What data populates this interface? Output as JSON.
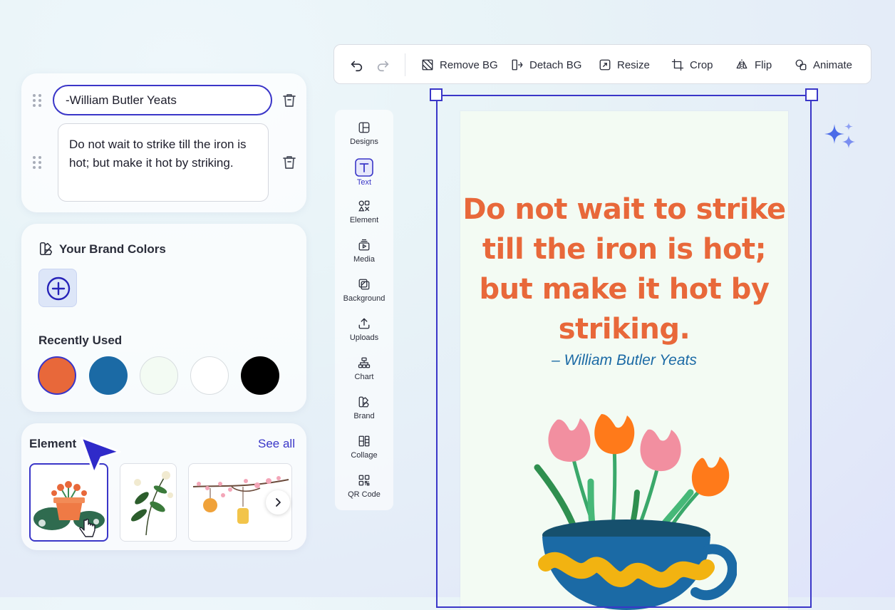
{
  "quote_editor": {
    "author_value": "-William Butler Yeats",
    "quote_value": "Do not wait to strike till the iron is hot; but make it hot by striking."
  },
  "brand": {
    "title": "Your Brand Colors",
    "recent_title": "Recently Used",
    "recent_colors": [
      "#e8683a",
      "#1b6aa5",
      "#f3fbf3",
      "#ffffff",
      "#000000"
    ]
  },
  "elements": {
    "title": "Element",
    "see_all": "See all"
  },
  "toolbar": {
    "remove_bg": "Remove BG",
    "detach_bg": "Detach BG",
    "resize": "Resize",
    "crop": "Crop",
    "flip": "Flip",
    "animate": "Animate"
  },
  "sidenav": {
    "items": [
      "Designs",
      "Text",
      "Element",
      "Media",
      "Background",
      "Uploads",
      "Chart",
      "Brand",
      "Collage",
      "QR Code"
    ],
    "active": "Text"
  },
  "design": {
    "quote": "Do not wait to strike till the iron is hot; but make it hot by striking.",
    "author": "– William Butler Yeats",
    "quote_color": "#e8683a",
    "author_color": "#1b6aa5",
    "background": "#f3fbf3"
  },
  "accent_color": "#3a36c8"
}
